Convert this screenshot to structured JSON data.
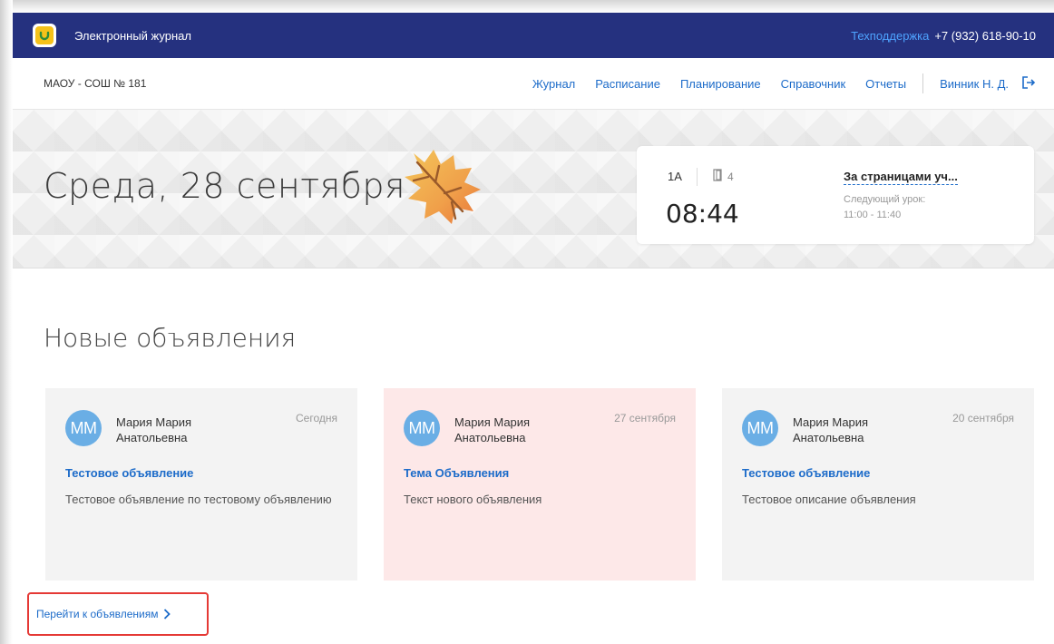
{
  "app": {
    "title": "Электронный журнал",
    "support_label": "Техподдержка",
    "support_phone": "+7 (932) 618-90-10"
  },
  "nav": {
    "school": "МАОУ - СОШ № 181",
    "items": [
      {
        "label": "Журнал"
      },
      {
        "label": "Расписание"
      },
      {
        "label": "Планирование"
      },
      {
        "label": "Справочник"
      },
      {
        "label": "Отчеты"
      }
    ],
    "user": "Винник Н. Д.",
    "logout_icon": "logout-icon"
  },
  "banner": {
    "date": "Среда, 28 сентября",
    "lesson": {
      "class": "1А",
      "room": "4",
      "time": "08:44",
      "subject": "За страницами уч...",
      "next_label": "Следующий урок:",
      "next_time": "11:00 - 11:40"
    }
  },
  "announcements": {
    "title": "Новые объявления",
    "cards": [
      {
        "initials": "ММ",
        "author_line1": "Мария Мария",
        "author_line2": "Анатольевна",
        "date": "Сегодня",
        "title": "Тестовое объявление",
        "text": "Тестовое объявление по тестовому объявлению"
      },
      {
        "initials": "ММ",
        "author_line1": "Мария Мария",
        "author_line2": "Анатольевна",
        "date": "27 сентября",
        "title": "Тема Объявления",
        "text": "Текст нового объявления"
      },
      {
        "initials": "ММ",
        "author_line1": "Мария Мария",
        "author_line2": "Анатольевна",
        "date": "20 сентября",
        "title": "Тестовое объявление",
        "text": "Тестовое описание объявления"
      }
    ],
    "goto_label": "Перейти к объявлениям"
  },
  "colors": {
    "header_bg": "#25317f",
    "link": "#1c6bc9",
    "avatar": "#6aaee5",
    "highlight_card": "#fde8e8",
    "callout_border": "#e53935"
  }
}
